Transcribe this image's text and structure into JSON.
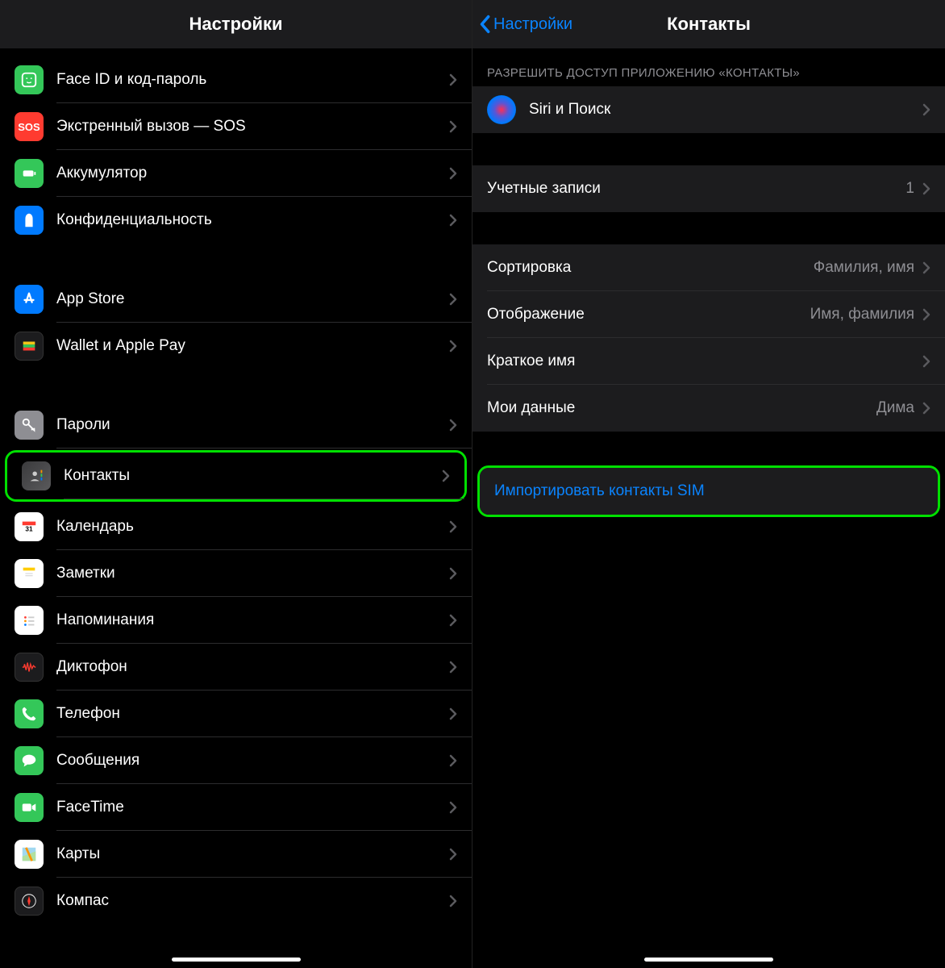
{
  "left": {
    "title": "Настройки",
    "groups": [
      [
        {
          "id": "faceid",
          "label": "Face ID и код-пароль",
          "icon": "faceid-icon",
          "bg": "bg-green"
        },
        {
          "id": "sos",
          "label": "Экстренный вызов — SOS",
          "icon": "sos-icon",
          "bg": "bg-red",
          "text": "SOS"
        },
        {
          "id": "battery",
          "label": "Аккумулятор",
          "icon": "battery-icon",
          "bg": "bg-green"
        },
        {
          "id": "privacy",
          "label": "Конфиденциальность",
          "icon": "privacy-icon",
          "bg": "bg-blue"
        }
      ],
      [
        {
          "id": "appstore",
          "label": "App Store",
          "icon": "appstore-icon",
          "bg": "bg-blue"
        },
        {
          "id": "wallet",
          "label": "Wallet и Apple Pay",
          "icon": "wallet-icon",
          "bg": "bg-black"
        }
      ],
      [
        {
          "id": "passwords",
          "label": "Пароли",
          "icon": "key-icon",
          "bg": "bg-grey"
        },
        {
          "id": "contacts",
          "label": "Контакты",
          "icon": "contacts-icon",
          "bg": "bg-grad",
          "highlight": true
        },
        {
          "id": "calendar",
          "label": "Календарь",
          "icon": "calendar-icon",
          "bg": "bg-white"
        },
        {
          "id": "notes",
          "label": "Заметки",
          "icon": "notes-icon",
          "bg": "bg-white"
        },
        {
          "id": "reminders",
          "label": "Напоминания",
          "icon": "reminders-icon",
          "bg": "bg-white"
        },
        {
          "id": "voicememo",
          "label": "Диктофон",
          "icon": "voicememo-icon",
          "bg": "bg-black"
        },
        {
          "id": "phone",
          "label": "Телефон",
          "icon": "phone-icon",
          "bg": "bg-green"
        },
        {
          "id": "messages",
          "label": "Сообщения",
          "icon": "messages-icon",
          "bg": "bg-green"
        },
        {
          "id": "facetime",
          "label": "FaceTime",
          "icon": "facetime-icon",
          "bg": "bg-green"
        },
        {
          "id": "maps",
          "label": "Карты",
          "icon": "maps-icon",
          "bg": "bg-white"
        },
        {
          "id": "compass",
          "label": "Компас",
          "icon": "compass-icon",
          "bg": "bg-black"
        }
      ]
    ]
  },
  "right": {
    "back": "Настройки",
    "title": "Контакты",
    "section_header": "РАЗРЕШИТЬ ДОСТУП ПРИЛОЖЕНИЮ «КОНТАКТЫ»",
    "siri": "Siri и Поиск",
    "accounts_label": "Учетные записи",
    "accounts_value": "1",
    "sort_label": "Сортировка",
    "sort_value": "Фамилия, имя",
    "display_label": "Отображение",
    "display_value": "Имя, фамилия",
    "shortname_label": "Краткое имя",
    "mydata_label": "Мои данные",
    "mydata_value": "Дима",
    "import_label": "Импортировать контакты SIM"
  }
}
